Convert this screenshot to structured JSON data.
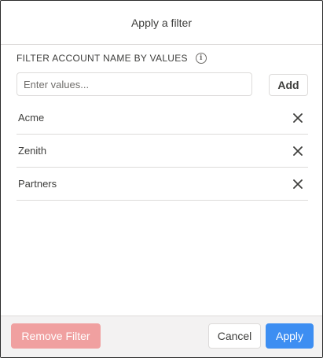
{
  "header": {
    "title": "Apply a filter"
  },
  "filter": {
    "section_title": "FILTER ACCOUNT NAME BY VALUES",
    "info_icon": "info-icon",
    "input_placeholder": "Enter values...",
    "input_value": "",
    "add_label": "Add",
    "values": [
      {
        "label": "Acme"
      },
      {
        "label": "Zenith"
      },
      {
        "label": "Partners"
      }
    ]
  },
  "footer": {
    "remove_filter_label": "Remove Filter",
    "cancel_label": "Cancel",
    "apply_label": "Apply"
  },
  "colors": {
    "primary": "#3d8ef2",
    "destructive_disabled": "#f0a0a0",
    "border": "#dddbda",
    "footer_bg": "#f3f2f2"
  }
}
